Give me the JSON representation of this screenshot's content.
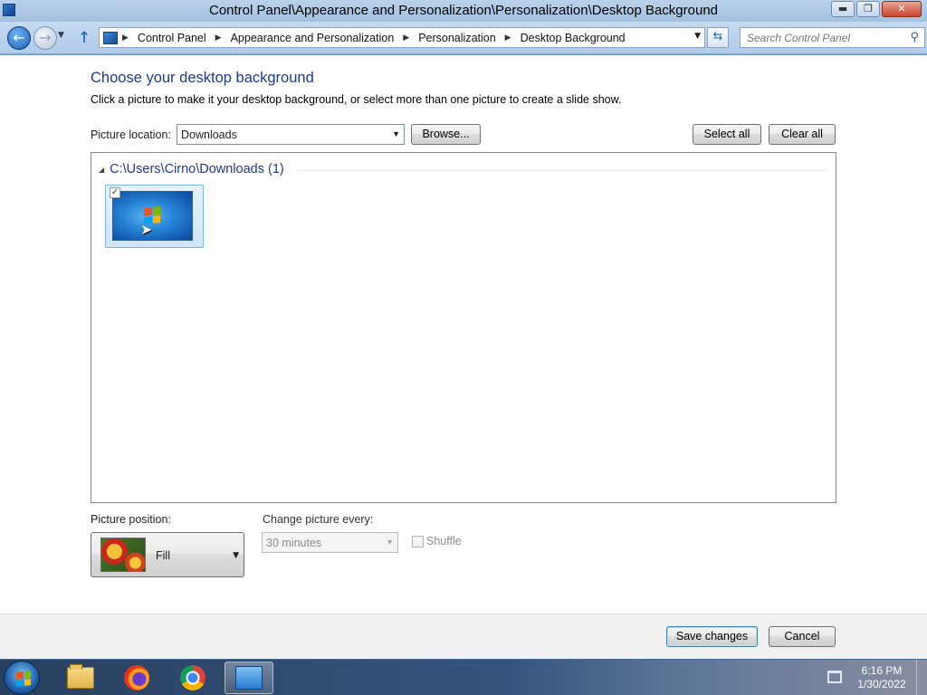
{
  "window": {
    "title": "Control Panel\\Appearance and Personalization\\Personalization\\Desktop Background",
    "minimize_label": "▬",
    "maximize_label": "❐",
    "close_label": "✕"
  },
  "address_bar": {
    "breadcrumbs": [
      "Control Panel",
      "Appearance and Personalization",
      "Personalization",
      "Desktop Background"
    ],
    "search_placeholder": "Search Control Panel"
  },
  "content": {
    "heading": "Choose your desktop background",
    "subtext": "Click a picture to make it your desktop background, or select more than one picture to create a slide show.",
    "picture_location_label": "Picture location:",
    "picture_location_value": "Downloads",
    "browse_label": "Browse...",
    "select_all_label": "Select all",
    "clear_all_label": "Clear all",
    "gallery": {
      "group_title": "C:\\Users\\Cirno\\Downloads (1)",
      "items": [
        {
          "checked": true
        }
      ]
    },
    "picture_position_label": "Picture position:",
    "picture_position_value": "Fill",
    "change_picture_label": "Change picture every:",
    "change_picture_value": "30 minutes",
    "shuffle_label": "Shuffle"
  },
  "footer": {
    "save_label": "Save changes",
    "cancel_label": "Cancel"
  },
  "taskbar": {
    "apps": [
      "windows-explorer",
      "firefox",
      "chrome",
      "control-panel"
    ],
    "clock_time": "6:16 PM",
    "clock_date": "1/30/2022"
  },
  "colors": {
    "heading": "#1e3a8e",
    "selection": "#cfe5fa",
    "windows_flag": [
      "#f25022",
      "#7fba00",
      "#00a4ef",
      "#ffb900"
    ]
  }
}
